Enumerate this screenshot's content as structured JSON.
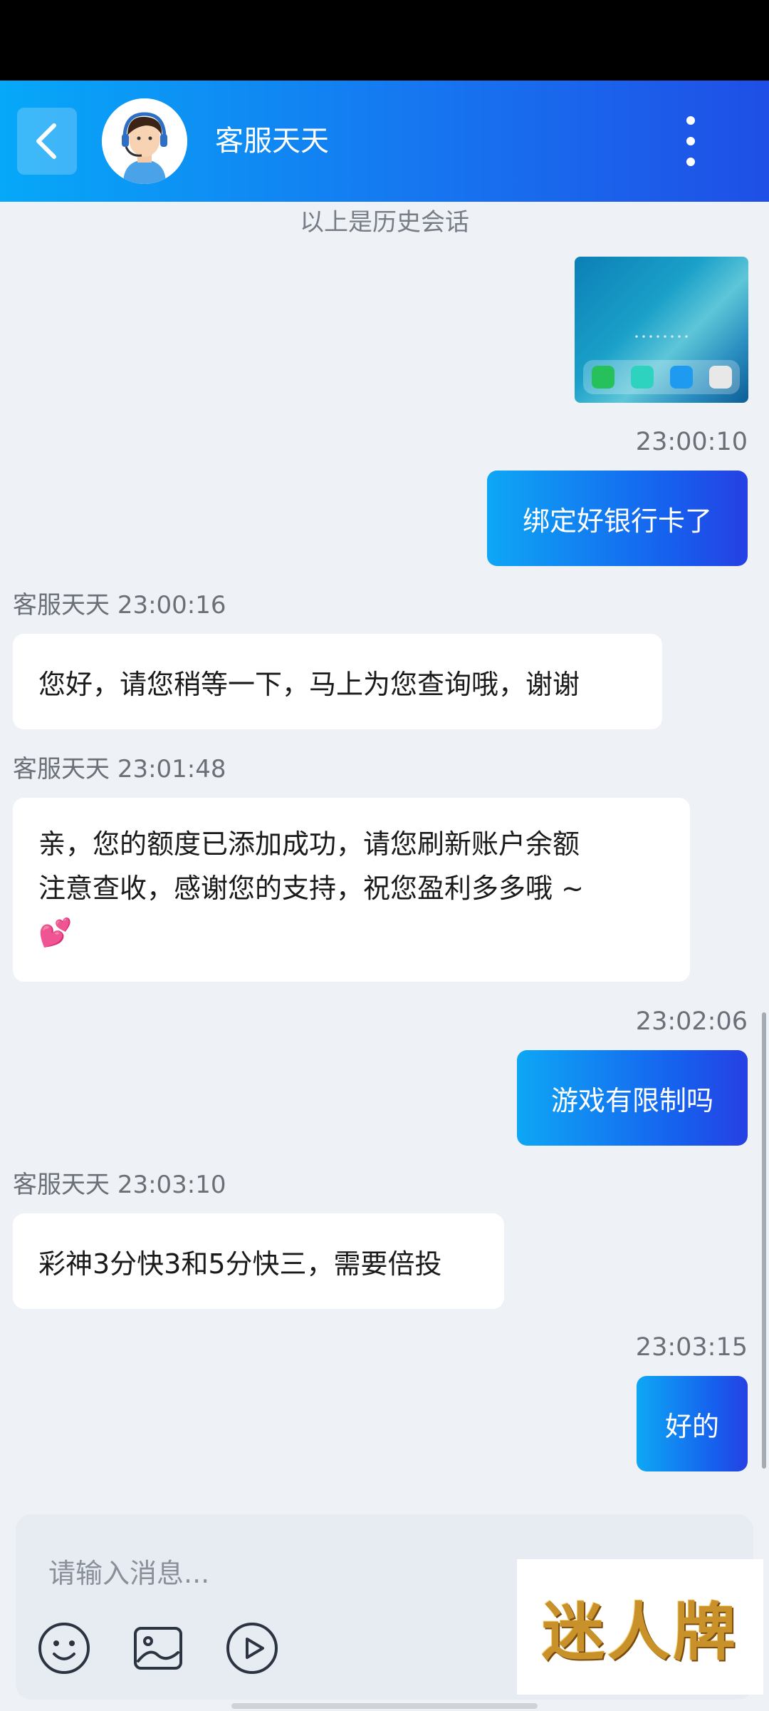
{
  "header": {
    "title": "客服天天",
    "back_icon": "chevron-left-icon",
    "menu_icon": "more-vertical-icon",
    "colors": {
      "gradient_start": "#06a8f8",
      "gradient_end": "#1f4fe6"
    }
  },
  "chat": {
    "history_label": "以上是历史会话",
    "messages": [
      {
        "direction": "out",
        "type": "image",
        "content": "手机主屏截图"
      },
      {
        "direction": "out",
        "time": "23:00:10",
        "text": "绑定好银行卡了"
      },
      {
        "direction": "in",
        "sender": "客服天天",
        "time": "23:00:16",
        "text": "您好，请您稍等一下，马上为您查询哦，谢谢"
      },
      {
        "direction": "in",
        "sender": "客服天天",
        "time": "23:01:48",
        "line1": "亲，您的额度已添加成功，请您刷新账户余额",
        "line2": "注意查收，感谢您的支持，祝您盈利多多哦 ~",
        "emoji": "💕"
      },
      {
        "direction": "out",
        "time": "23:02:06",
        "text": "游戏有限制吗"
      },
      {
        "direction": "in",
        "sender": "客服天天",
        "time": "23:03:10",
        "text": "彩神3分快3和5分快三，需要倍投"
      },
      {
        "direction": "out",
        "time": "23:03:15",
        "text": "好的"
      }
    ]
  },
  "composer": {
    "placeholder": "请输入消息...",
    "tools": [
      "emoji-icon",
      "image-icon",
      "video-play-icon"
    ]
  },
  "watermark": {
    "text": "迷人牌"
  }
}
